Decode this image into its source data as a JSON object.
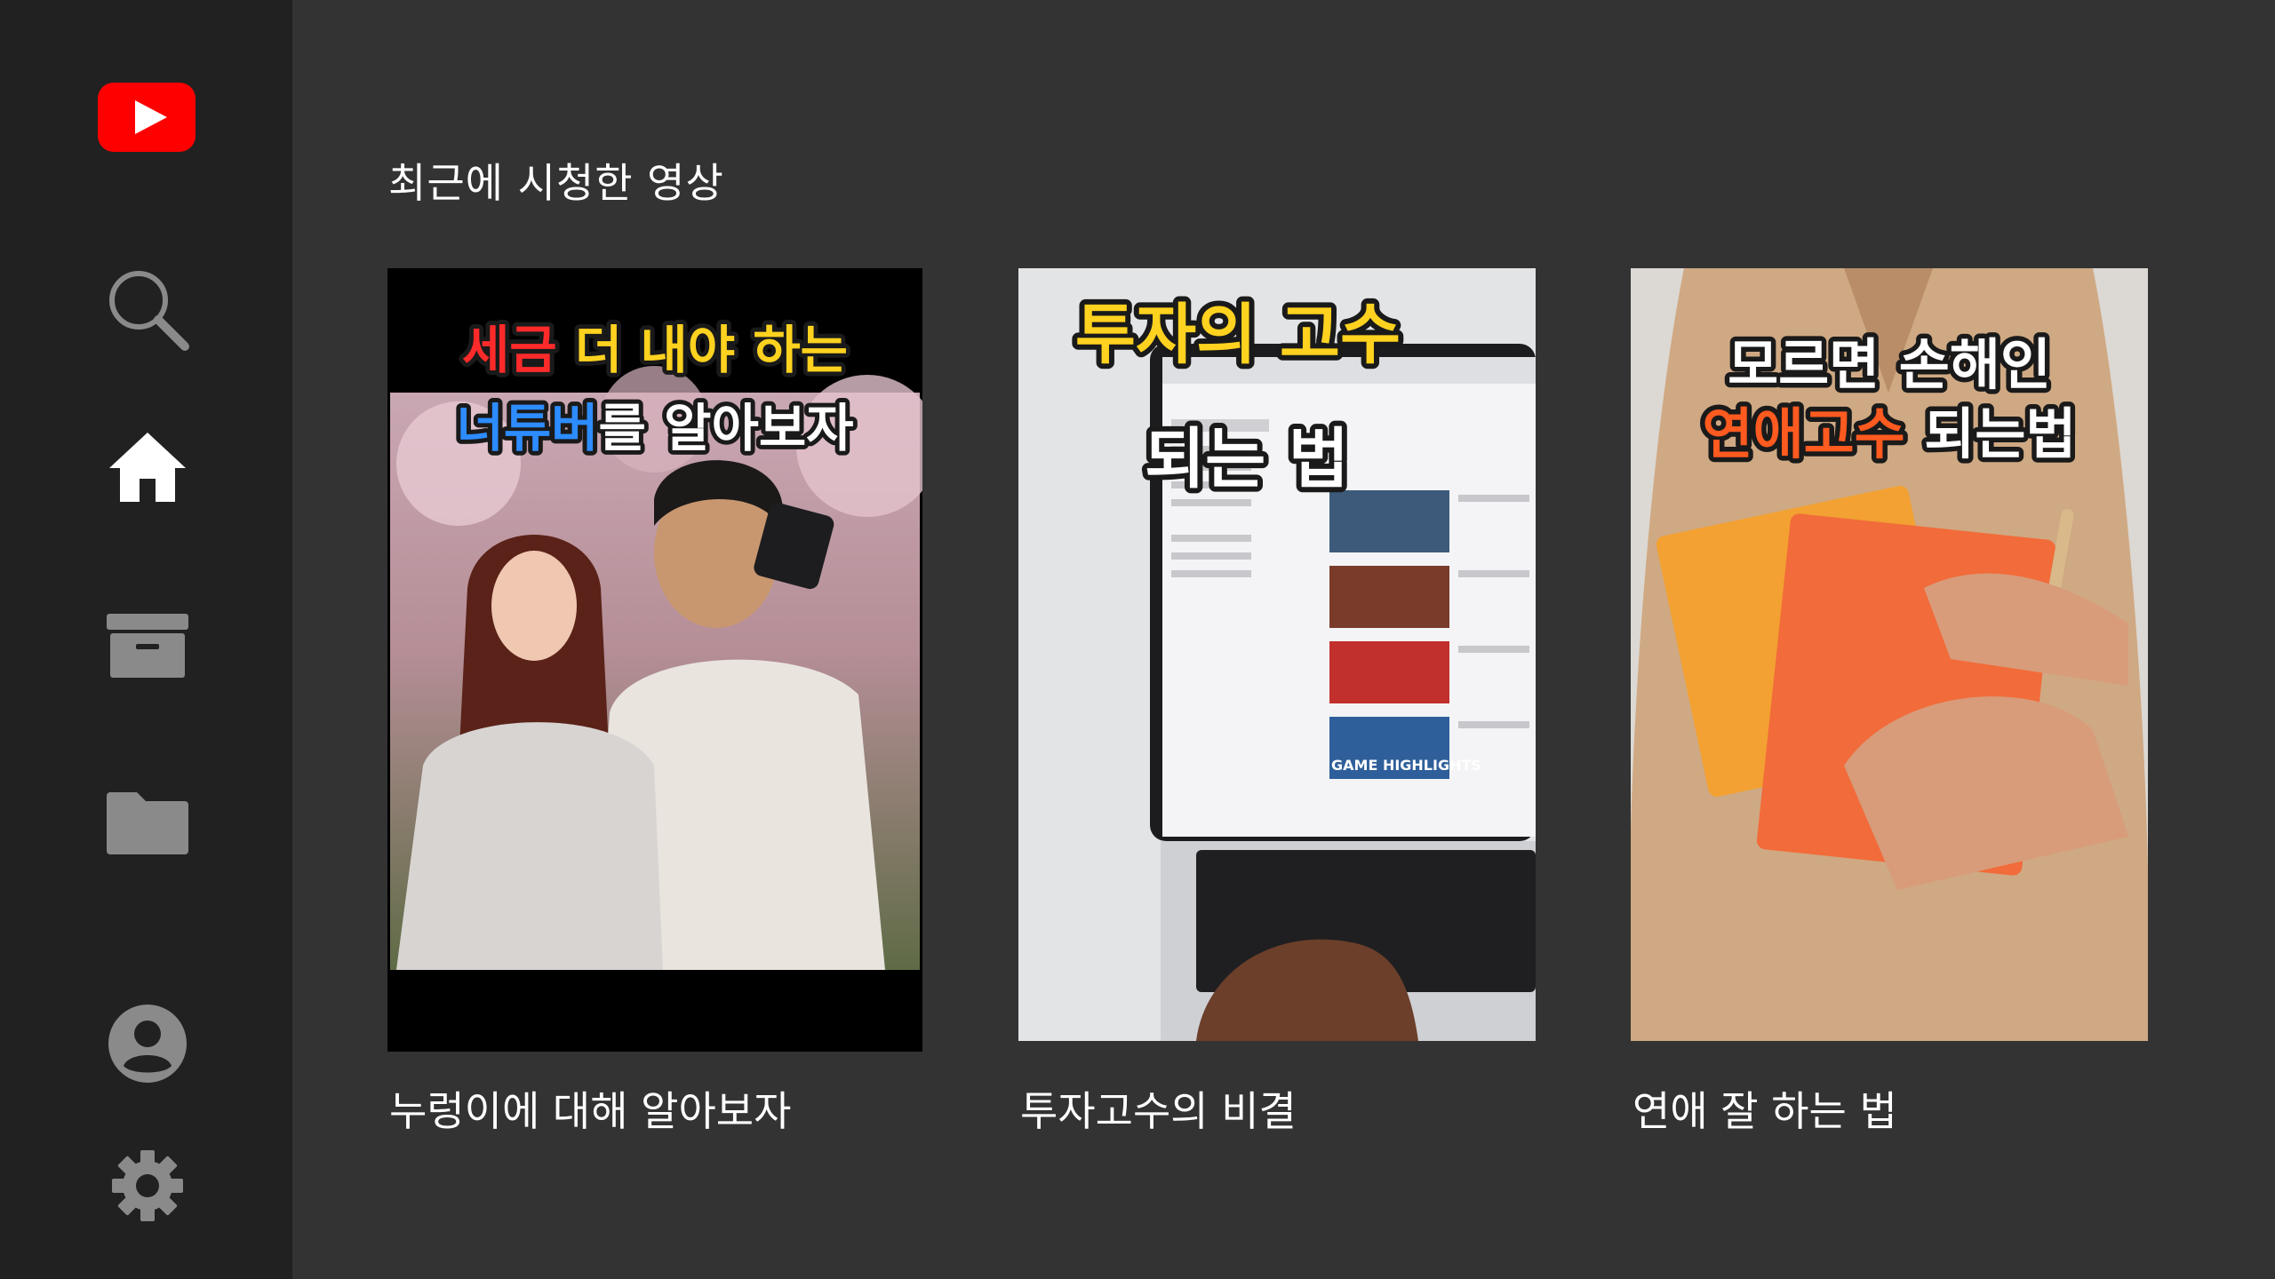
{
  "sidebar": {
    "logo": {
      "icon": "youtube-logo-icon",
      "color": "#FF0000"
    },
    "items": [
      {
        "icon": "search-icon",
        "active": false
      },
      {
        "icon": "home-icon",
        "active": true
      },
      {
        "icon": "archive-box-icon",
        "active": false
      },
      {
        "icon": "folder-icon",
        "active": false
      },
      {
        "icon": "account-circle-icon",
        "active": false
      },
      {
        "icon": "gear-icon",
        "active": false
      }
    ]
  },
  "main": {
    "section_title": "최근에 시청한 영상",
    "videos": [
      {
        "title": "누렁이에 대해 알아보자",
        "thumbnail": {
          "line1_parts": [
            {
              "text": "세금 ",
              "color": "#ff2a2a"
            },
            {
              "text": "더 내야 하는",
              "color": "#ffd21f"
            }
          ],
          "line2_parts": [
            {
              "text": "너튜버",
              "color": "#2d8cff"
            },
            {
              "text": "를 알아보자",
              "color": "#ffffff"
            }
          ]
        }
      },
      {
        "title": "투자고수의 비결",
        "thumbnail": {
          "line1_parts": [
            {
              "text": "투자의 고수",
              "color": "#ffd21f"
            }
          ],
          "line2_parts": [
            {
              "text": "되는 법",
              "color": "#ffffff"
            }
          ],
          "screen_caption": "GAME HIGHLIGHTS"
        }
      },
      {
        "title": "연애 잘 하는 법",
        "thumbnail": {
          "line1_parts": [
            {
              "text": "모르면 손해인",
              "color": "#ffffff"
            }
          ],
          "line2_parts": [
            {
              "text": "연애고수",
              "color": "#ff5a1f"
            },
            {
              "text": " 되는법",
              "color": "#ffffff"
            }
          ]
        }
      }
    ]
  }
}
